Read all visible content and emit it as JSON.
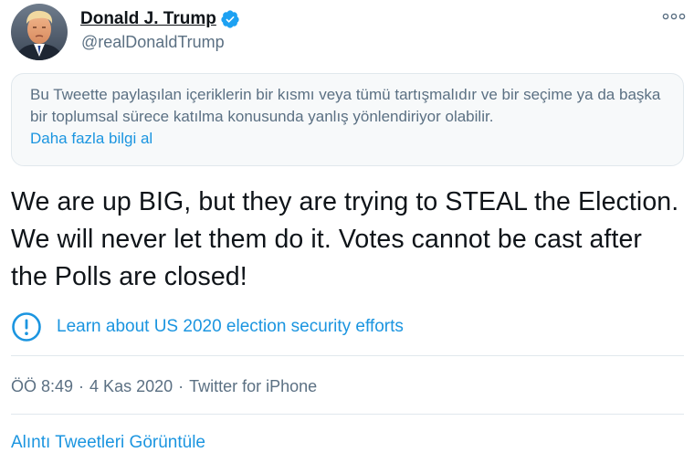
{
  "author": {
    "name": "Donald J. Trump",
    "handle": "@realDonaldTrump",
    "verified": true
  },
  "notice": {
    "text": "Bu Tweette paylaşılan içeriklerin bir kısmı veya tümü tartışmalıdır ve bir seçime ya da başka bir toplumsal sürece katılma konusunda yanlış yönlendiriyor olabilir.",
    "link": "Daha fazla bilgi al"
  },
  "tweet": {
    "text": "We are up BIG, but they are trying to STEAL the Election. We will never let them do it. Votes cannot be cast after the Polls are closed!"
  },
  "election_label": {
    "icon": "exclamation-circle-icon",
    "text": "Learn about US 2020 election security efforts"
  },
  "meta": {
    "time": "ÖÖ 8:49",
    "separator": "·",
    "date": "4 Kas 2020",
    "source": "Twitter for iPhone"
  },
  "actions": {
    "quotes_link": "Alıntı Tweetleri Görüntüle"
  },
  "icons": {
    "avatar": "avatar-photo",
    "verified": "verified-badge-icon",
    "more": "more-dots-icon"
  },
  "colors": {
    "link": "#1b95e0",
    "secondary_text": "#5b7083",
    "primary_text": "#0f1419",
    "notice_bg": "#f7f9fa",
    "border": "#e1e8ed",
    "verified": "#1da1f2"
  }
}
